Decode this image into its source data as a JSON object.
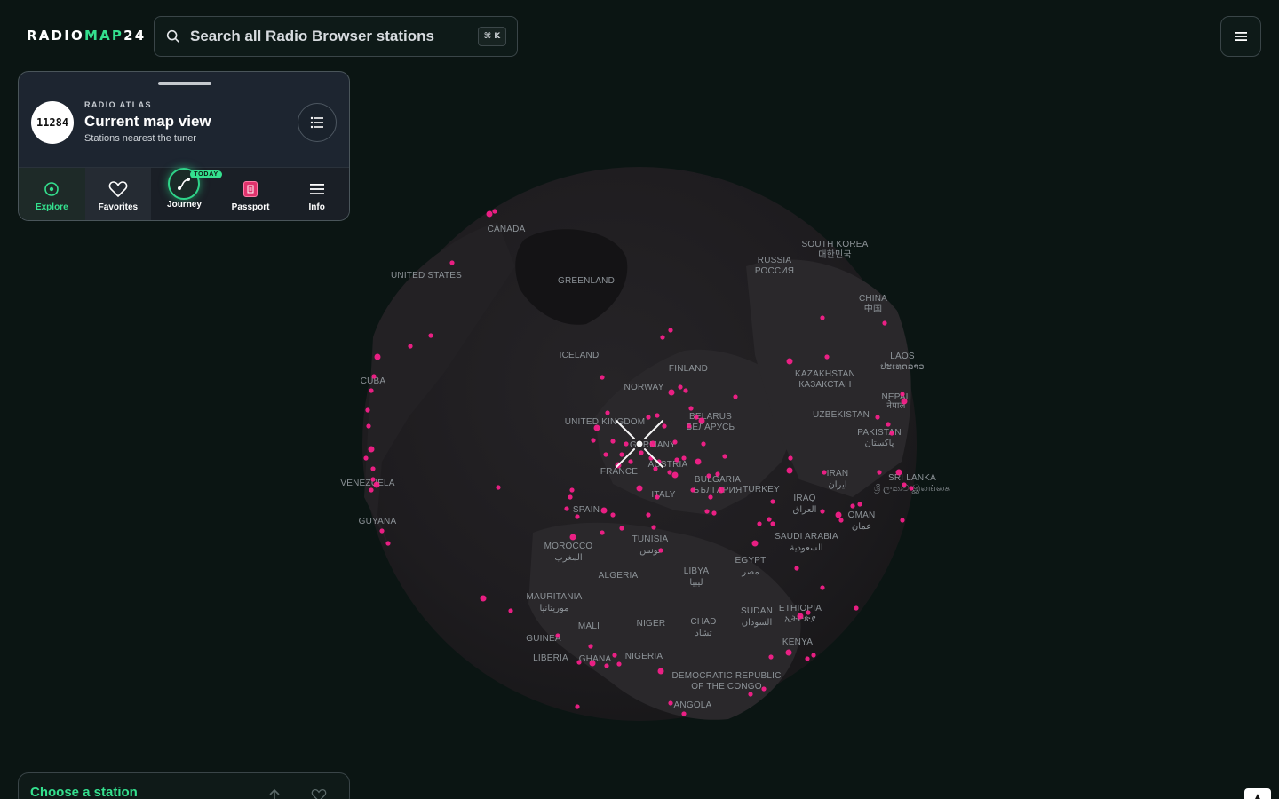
{
  "header": {
    "logo_part1": "RADIO",
    "logo_part2": "MAP",
    "logo_part3": "24",
    "search_placeholder": "Search all Radio Browser stations",
    "shortcut": "⌘ K",
    "menu_icon": "hamburger-icon"
  },
  "atlas": {
    "count": "11284",
    "eyebrow": "RADIO ATLAS",
    "title": "Current map view",
    "subtitle": "Stations nearest the tuner",
    "list_icon": "list-icon",
    "tabs": [
      {
        "label": "Explore",
        "icon": "compass-icon"
      },
      {
        "label": "Favorites",
        "icon": "heart-icon"
      },
      {
        "label": "Journey",
        "icon": "route-icon",
        "badge": "TODAY"
      },
      {
        "label": "Passport",
        "icon": "passport-icon"
      },
      {
        "label": "Info",
        "icon": "menu-icon"
      }
    ]
  },
  "map": {
    "labels": [
      "CANADA",
      "UNITED STATES",
      "GREENLAND",
      "SOUTH KOREA",
      "대한민국",
      "RUSSIA",
      "РОССИЯ",
      "CHINA",
      "中国",
      "ICELAND",
      "FINLAND",
      "NORWAY",
      "KAZAKHSTAN",
      "КАЗАКСТАН",
      "LAOS",
      "ປະເທດລາວ",
      "CUBA",
      "UNITED KINGDOM",
      "BELARUS",
      "БЕЛАРУСЬ",
      "UZBEKISTAN",
      "NEPAL",
      "नेपाल",
      "GERMANY",
      "PAKISTAN",
      "پاکستان",
      "FRANCE",
      "AUSTRIA",
      "IRAN",
      "ایران",
      "SRI LANKA",
      "ශ්‍රී ලංකාව இலங்கை",
      "VENEZUELA",
      "BULGARIA",
      "БЪЛГАРИЯ",
      "TURKEY",
      "ITALY",
      "IRAQ",
      "العراق",
      "SPAIN",
      "OMAN",
      "عمان",
      "GUYANA",
      "TUNISIA",
      "تونس",
      "SAUDI ARABIA",
      "السعودية",
      "MOROCCO",
      "المغرب",
      "EGYPT",
      "مصر",
      "ALGERIA",
      "LIBYA",
      "ليبيا",
      "MAURITANIA",
      "موريتانيا",
      "SUDAN",
      "السودان",
      "ETHIOPIA",
      "ኢትዮጵያ",
      "MALI",
      "NIGER",
      "CHAD",
      "تشاد",
      "GUINEA",
      "KENYA",
      "LIBERIA",
      "GHANA",
      "NIGERIA",
      "DEMOCRATIC REPUBLIC",
      "OF THE CONGO",
      "ANGOLA"
    ],
    "station_color": "#ff1f8e",
    "accent_color": "#34e08e"
  },
  "bottom": {
    "title": "Choose a station",
    "corner_label": "▲"
  }
}
